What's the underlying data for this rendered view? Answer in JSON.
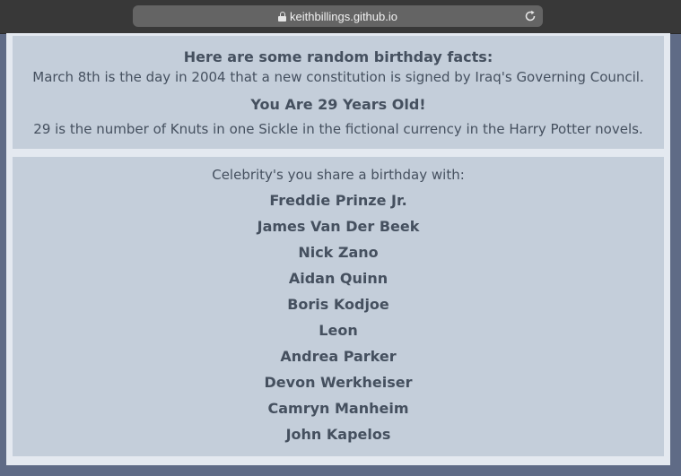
{
  "browser": {
    "url": "keithbillings.github.io"
  },
  "facts": {
    "heading": "Here are some random birthday facts:",
    "date_fact": "March 8th is the day in 2004 that a new constitution is signed by Iraq's Governing Council.",
    "age": "You Are 29 Years Old!",
    "number_fact": "29 is the number of Knuts in one Sickle in the fictional currency in the Harry Potter novels."
  },
  "celebrities": {
    "heading": "Celebrity's you share a birthday with:",
    "names": [
      "Freddie Prinze Jr.",
      "James Van Der Beek",
      "Nick Zano",
      "Aidan Quinn",
      "Boris Kodjoe",
      "Leon",
      "Andrea Parker",
      "Devon Werkheiser",
      "Camryn Manheim",
      "John Kapelos"
    ]
  }
}
